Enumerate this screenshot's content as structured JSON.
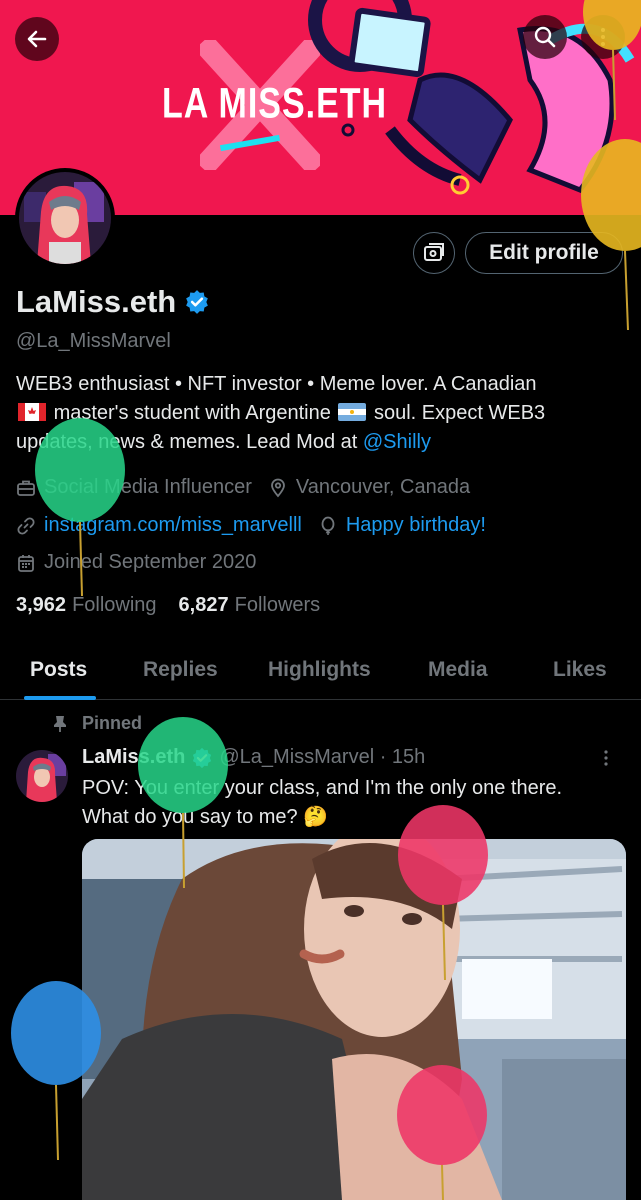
{
  "banner": {
    "logo_text": "LA MISS.ETH",
    "bg_color": "#f0174f"
  },
  "header_buttons": {
    "back_icon": "arrow-left-icon",
    "search_icon": "search-icon",
    "more_icon": "more-vertical-icon"
  },
  "profile": {
    "name": "LaMiss.eth",
    "verified_icon": "verified-badge-icon",
    "handle": "@La_MissMarvel",
    "edit_label": "Edit profile",
    "bio_part1": "WEB3 enthusiast • NFT investor • Meme lover. A Canadian",
    "bio_part2": "master's student with Argentine",
    "bio_part3": "soul. Expect WEB3 updates, news & memes.  Lead Mod at",
    "bio_mention": "@Shilly",
    "category": "Social Media Influencer",
    "location": "Vancouver, Canada",
    "website": "instagram.com/miss_marvelll",
    "birthday": "Happy birthday!",
    "joined": "Joined September 2020",
    "following_count": "3,962",
    "following_label": "Following",
    "followers_count": "6,827",
    "followers_label": "Followers"
  },
  "tabs": [
    {
      "label": "Posts",
      "active": true
    },
    {
      "label": "Replies",
      "active": false
    },
    {
      "label": "Highlights",
      "active": false
    },
    {
      "label": "Media",
      "active": false
    },
    {
      "label": "Likes",
      "active": false
    }
  ],
  "pinned_post": {
    "pinned_label": "Pinned",
    "author": "LaMiss.eth",
    "handle_time": "@La_MissMarvel · 15h",
    "text_line1": "POV: You enter your class, and I'm the only one there.",
    "text_line2": "What do you say to me? 🤔"
  },
  "colors": {
    "accent": "#1d9bf0",
    "muted": "#71767b",
    "text": "#e7e9ea",
    "background": "#000000"
  }
}
